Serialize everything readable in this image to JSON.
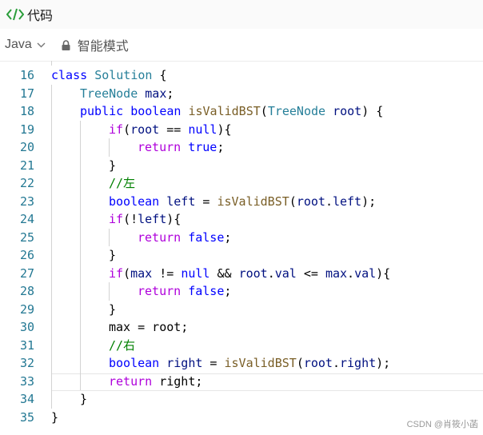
{
  "header": {
    "title": "代码",
    "icon": "code-icon"
  },
  "toolbar": {
    "language": "Java",
    "mode": "智能模式"
  },
  "editor": {
    "lines": [
      {
        "n": "16",
        "indent": 0,
        "tokens": [
          [
            "kw",
            "class"
          ],
          [
            "plain",
            " "
          ],
          [
            "type",
            "Solution"
          ],
          [
            "plain",
            " {"
          ]
        ]
      },
      {
        "n": "17",
        "indent": 1,
        "tokens": [
          [
            "type",
            "TreeNode"
          ],
          [
            "plain",
            " "
          ],
          [
            "var",
            "max"
          ],
          [
            "plain",
            ";"
          ]
        ]
      },
      {
        "n": "18",
        "indent": 1,
        "tokens": [
          [
            "kw",
            "public"
          ],
          [
            "plain",
            " "
          ],
          [
            "kw",
            "boolean"
          ],
          [
            "plain",
            " "
          ],
          [
            "fn",
            "isValidBST"
          ],
          [
            "plain",
            "("
          ],
          [
            "type",
            "TreeNode"
          ],
          [
            "plain",
            " "
          ],
          [
            "var",
            "root"
          ],
          [
            "plain",
            ") {"
          ]
        ]
      },
      {
        "n": "19",
        "indent": 2,
        "tokens": [
          [
            "ctrl",
            "if"
          ],
          [
            "plain",
            "("
          ],
          [
            "var",
            "root"
          ],
          [
            "plain",
            " == "
          ],
          [
            "kw",
            "null"
          ],
          [
            "plain",
            "){"
          ]
        ]
      },
      {
        "n": "20",
        "indent": 3,
        "tokens": [
          [
            "ctrl",
            "return"
          ],
          [
            "plain",
            " "
          ],
          [
            "kw",
            "true"
          ],
          [
            "plain",
            ";"
          ]
        ]
      },
      {
        "n": "21",
        "indent": 2,
        "tokens": [
          [
            "plain",
            "}"
          ]
        ]
      },
      {
        "n": "22",
        "indent": 2,
        "tokens": [
          [
            "com",
            "//左"
          ]
        ]
      },
      {
        "n": "23",
        "indent": 2,
        "tokens": [
          [
            "kw",
            "boolean"
          ],
          [
            "plain",
            " "
          ],
          [
            "var",
            "left"
          ],
          [
            "plain",
            " = "
          ],
          [
            "fn",
            "isValidBST"
          ],
          [
            "plain",
            "("
          ],
          [
            "var",
            "root"
          ],
          [
            "plain",
            "."
          ],
          [
            "var",
            "left"
          ],
          [
            "plain",
            ");"
          ]
        ]
      },
      {
        "n": "24",
        "indent": 2,
        "tokens": [
          [
            "ctrl",
            "if"
          ],
          [
            "plain",
            "(!"
          ],
          [
            "var",
            "left"
          ],
          [
            "plain",
            "){"
          ]
        ]
      },
      {
        "n": "25",
        "indent": 3,
        "tokens": [
          [
            "ctrl",
            "return"
          ],
          [
            "plain",
            " "
          ],
          [
            "kw",
            "false"
          ],
          [
            "plain",
            ";"
          ]
        ]
      },
      {
        "n": "26",
        "indent": 2,
        "tokens": [
          [
            "plain",
            "}"
          ]
        ]
      },
      {
        "n": "27",
        "indent": 2,
        "tokens": [
          [
            "ctrl",
            "if"
          ],
          [
            "plain",
            "("
          ],
          [
            "var",
            "max"
          ],
          [
            "plain",
            " != "
          ],
          [
            "kw",
            "null"
          ],
          [
            "plain",
            " && "
          ],
          [
            "var",
            "root"
          ],
          [
            "plain",
            "."
          ],
          [
            "var",
            "val"
          ],
          [
            "plain",
            " <= "
          ],
          [
            "var",
            "max"
          ],
          [
            "plain",
            "."
          ],
          [
            "var",
            "val"
          ],
          [
            "plain",
            "){"
          ]
        ]
      },
      {
        "n": "28",
        "indent": 3,
        "tokens": [
          [
            "ctrl",
            "return"
          ],
          [
            "plain",
            " "
          ],
          [
            "kw",
            "false"
          ],
          [
            "plain",
            ";"
          ]
        ]
      },
      {
        "n": "29",
        "indent": 2,
        "tokens": [
          [
            "plain",
            "}"
          ]
        ]
      },
      {
        "n": "30",
        "indent": 2,
        "tokens": [
          [
            "plain",
            "max = root;"
          ]
        ]
      },
      {
        "n": "31",
        "indent": 2,
        "tokens": [
          [
            "com",
            "//右"
          ]
        ]
      },
      {
        "n": "32",
        "indent": 2,
        "tokens": [
          [
            "kw",
            "boolean"
          ],
          [
            "plain",
            " "
          ],
          [
            "var",
            "right"
          ],
          [
            "plain",
            " = "
          ],
          [
            "fn",
            "isValidBST"
          ],
          [
            "plain",
            "("
          ],
          [
            "var",
            "root"
          ],
          [
            "plain",
            "."
          ],
          [
            "var",
            "right"
          ],
          [
            "plain",
            ");"
          ]
        ]
      },
      {
        "n": "33",
        "indent": 2,
        "current": true,
        "tokens": [
          [
            "ctrl",
            "return"
          ],
          [
            "plain",
            " right;"
          ]
        ]
      },
      {
        "n": "34",
        "indent": 1,
        "tokens": [
          [
            "plain",
            "}"
          ]
        ]
      },
      {
        "n": "35",
        "indent": 0,
        "tokens": [
          [
            "plain",
            "}"
          ]
        ]
      }
    ]
  },
  "watermark": "CSDN @肖筱小菡"
}
